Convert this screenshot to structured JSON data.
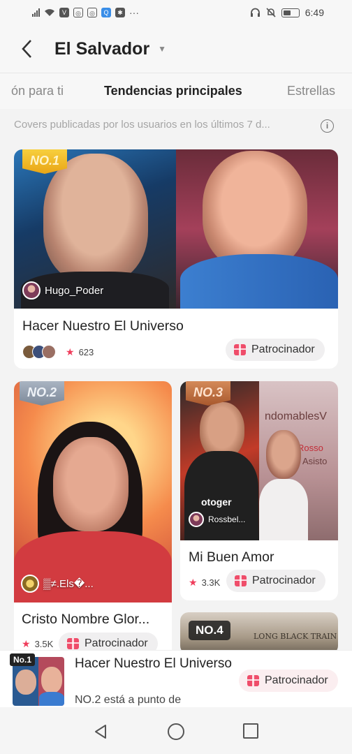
{
  "status_bar": {
    "time": "6:49",
    "icons": [
      "signal-icon",
      "wifi-icon",
      "v-app-icon",
      "instagram-icon",
      "instagram-icon",
      "search-app-icon",
      "photo-app-icon",
      "more-dots-icon"
    ],
    "right_icons": [
      "headset-icon",
      "mute-icon",
      "battery-icon"
    ],
    "more": "···"
  },
  "header": {
    "title": "El Salvador",
    "back_icon": "back-arrow-icon",
    "dropdown_icon": "caret-down-icon"
  },
  "tabs": [
    {
      "label": "ón para ti",
      "active": false
    },
    {
      "label": "Tendencias principales",
      "active": true
    },
    {
      "label": "Estrellas",
      "active": false
    }
  ],
  "subtitle": "Covers publicadas por los usuarios en los últimos 7 d...",
  "info_icon": "i",
  "cards": [
    {
      "rank": "NO.1",
      "owner": "Hugo_Poder",
      "title": "Hacer Nuestro El Universo",
      "likes": "623",
      "sponsor_label": "Patrocinador"
    },
    {
      "rank": "NO.2",
      "owner": "▒≠.Els�...",
      "title": "Cristo Nombre Glor...",
      "likes": "3.5K",
      "sponsor_label": "Patrocinador"
    },
    {
      "rank": "NO.3",
      "owner": "Rossbel...",
      "overlay_text_1": "otoger",
      "overlay_text_2": "ndomablesV",
      "overlay_text_3": "Rosso",
      "overlay_text_4": "Asisto",
      "title": "Mi Buen Amor",
      "likes": "3.3K",
      "sponsor_label": "Patrocinador"
    },
    {
      "rank": "NO.4",
      "overlay_text": "LONG BLACK TRAIN"
    }
  ],
  "notification": {
    "badge": "No.1",
    "title": "Hacer Nuestro El Universo",
    "subtitle": "NO.2 está a punto de",
    "sponsor_label": "Patrocinador"
  },
  "colors": {
    "accent_red": "#ef3d5b",
    "gold_badge": "#f2bf2c",
    "silver_badge": "#8f9aa8",
    "bronze_badge": "#c06d3e"
  }
}
